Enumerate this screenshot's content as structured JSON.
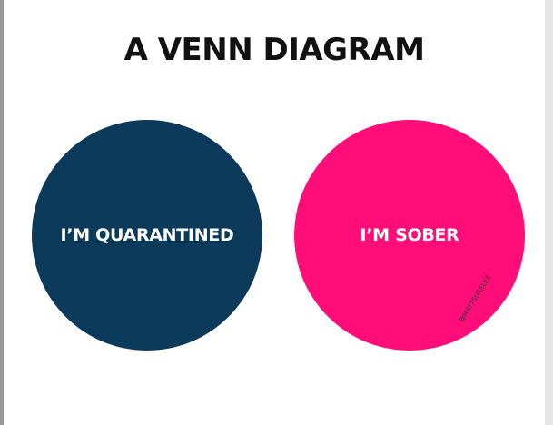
{
  "title": "A VENN DIAGRAM",
  "sets": [
    {
      "label": "I’M QUARANTINED",
      "color": "#0c3a5a"
    },
    {
      "label": "I’M SOBER",
      "color": "#ff0d78"
    }
  ],
  "credit": "@MATTSURELEE"
}
